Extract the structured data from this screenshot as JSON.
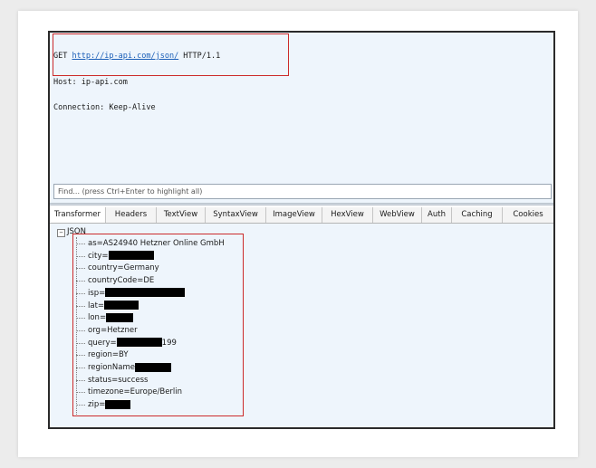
{
  "request": {
    "lines": [
      {
        "method": "GET ",
        "url": "http://ip-api.com/json/",
        "protocol": " HTTP/1.1"
      },
      {
        "text": "Host: ip-api.com"
      },
      {
        "text": "Connection: Keep-Alive"
      }
    ]
  },
  "find": {
    "placeholder": "Find... (press Ctrl+Enter to highlight all)"
  },
  "tabs": [
    "Transformer",
    "Headers",
    "TextView",
    "SyntaxView",
    "ImageView",
    "HexView",
    "WebView",
    "Auth",
    "Caching",
    "Cookies"
  ],
  "tree": {
    "toggle": "−",
    "root": "JSON",
    "items": [
      {
        "text": "as=AS24940 Hetzner Online GmbH"
      },
      {
        "text": "city=",
        "redact": 50
      },
      {
        "text": "country=Germany"
      },
      {
        "text": "countryCode=DE"
      },
      {
        "text": "isp=",
        "redact": 88
      },
      {
        "text": "lat=",
        "redact": 38
      },
      {
        "text": "lon=",
        "redact": 30
      },
      {
        "text": "org=Hetzner"
      },
      {
        "text": "query=",
        "redact": 50,
        "suffix": "199"
      },
      {
        "text": "region=BY"
      },
      {
        "text": "regionName",
        "redact": 40
      },
      {
        "text": "status=success"
      },
      {
        "text": "timezone=Europe/Berlin"
      },
      {
        "text": "zip=",
        "redact": 28
      }
    ]
  },
  "colors": {
    "highlight_border": "#cc2b2b",
    "pane_bg": "#eef5fc",
    "link": "#1b5fb8"
  }
}
